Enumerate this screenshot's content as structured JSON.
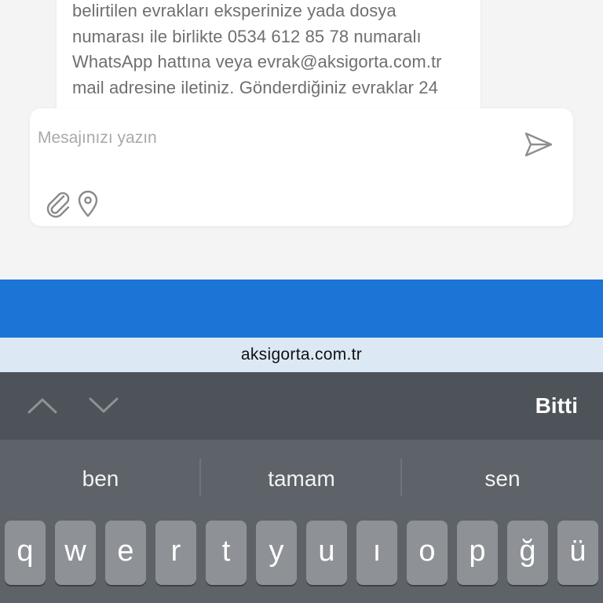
{
  "message": {
    "lines": [
      "belirtilen evrakları eksperinize yada dosya",
      "numarası ile birlikte 0534 612 85 78 numaralı",
      "WhatsApp hattına veya evrak@aksigorta.com.tr",
      "mail adresine iletiniz. Gönderdiğiniz evraklar 24"
    ]
  },
  "composer": {
    "placeholder": "Mesajınızı yazın",
    "value": "",
    "send_icon": "send-icon",
    "attach_icon": "paperclip-icon",
    "location_icon": "map-pin-icon"
  },
  "browser": {
    "url": "aksigorta.com.tr"
  },
  "keyboard_toolbar": {
    "done_label": "Bitti",
    "prev_icon": "chevron-up-icon",
    "next_icon": "chevron-down-icon"
  },
  "keyboard": {
    "suggestions": [
      "ben",
      "tamam",
      "sen"
    ],
    "row1": [
      "q",
      "w",
      "e",
      "r",
      "t",
      "y",
      "u",
      "ı",
      "o",
      "p",
      "ğ",
      "ü"
    ]
  },
  "colors": {
    "accent_blue": "#1c74d6",
    "url_bar_bg": "#dde8f5",
    "keyboard_bg": "#5d6369",
    "toolbar_bg": "#4d5359",
    "key_bg": "#8e9296"
  }
}
